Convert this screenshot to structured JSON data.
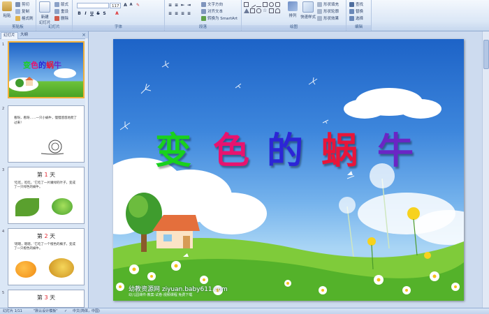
{
  "ribbon": {
    "clipboard": {
      "paste": "粘贴",
      "cut": "剪切",
      "copy": "复制",
      "format_painter": "格式刷",
      "label": "剪贴板"
    },
    "slides": {
      "new_slide": "新建\n幻灯片",
      "layout": "版式",
      "reset": "重设",
      "delete": "删除",
      "label": "幻灯片"
    },
    "font": {
      "font_name": "",
      "font_size": "117",
      "label": "字体"
    },
    "paragraph": {
      "text_direction": "文字方向",
      "align_text": "对齐文本",
      "smartart": "转换为 SmartArt",
      "label": "段落"
    },
    "drawing": {
      "arrange": "排列",
      "quick_styles": "快速样式",
      "shape_fill": "形状填充",
      "shape_outline": "形状轮廓",
      "shape_effects": "形状效果",
      "label": "绘图"
    },
    "editing": {
      "find": "查找",
      "replace": "替换",
      "select": "选择",
      "label": "编辑"
    }
  },
  "left_pane": {
    "tab_slides": "幻灯片",
    "tab_outline": "大纲",
    "close": "×",
    "slides": [
      {
        "num": "1",
        "title": "变色的蜗牛"
      },
      {
        "num": "2",
        "text": "看呀，看呀……一只小蜗牛，慢慢悠悠地爬了过来！"
      },
      {
        "num": "3",
        "heading_a": "第",
        "heading_b": "1",
        "heading_c": "天",
        "text": "'吃吃，吃吃，'它吃了一片嫩绿的叶子，变成了一只绿色的蜗牛。"
      },
      {
        "num": "4",
        "heading_a": "第",
        "heading_b": "2",
        "heading_c": "天",
        "text": "'嗯嗯，嗯嗯，'它吃了一个橙色的橘子，变成了一只橙色的蜗牛。"
      },
      {
        "num": "5",
        "heading_a": "第",
        "heading_b": "3",
        "heading_c": "天"
      }
    ]
  },
  "slide": {
    "title_chars": [
      {
        "char": "变",
        "color": "#19d11d"
      },
      {
        "char": "色",
        "color": "#e8136f"
      },
      {
        "char": "的",
        "color": "#2c25d6"
      },
      {
        "char": "蜗",
        "color": "#e8153a"
      },
      {
        "char": "牛",
        "color": "#6b25c5"
      }
    ],
    "watermark": "幼教资源网 ziyuan.baby611.com",
    "watermark_sub": "幼儿园课件·教案·试卷·视频课程 免费下载"
  },
  "status": {
    "slide_info": "幻灯片 1/11",
    "theme": "\"默认设计模板\"",
    "language": "中文(简体，中国)"
  },
  "colors": {
    "ribbon_bg": "#dbe7f6",
    "accent_border": "#f2b03a",
    "sky_top": "#1d63c7",
    "grass": "#5cbf2a"
  }
}
